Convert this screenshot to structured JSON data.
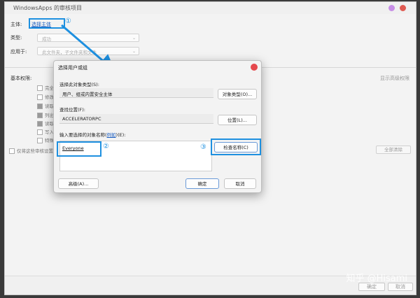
{
  "outer_window": {
    "title": "WindowsApps 的审核项目",
    "principal_label": "主体:",
    "principal_link": "选择主体",
    "type_label": "类型:",
    "type_value": "成功",
    "applies_label": "应用于:",
    "applies_value": "此文件夹，子文件夹和文件",
    "basic_permissions_label": "基本权限:",
    "show_advanced": "显示高级权限",
    "permissions": [
      {
        "label": "完全",
        "checked": false
      },
      {
        "label": "修改",
        "checked": false
      },
      {
        "label": "读取",
        "checked": true
      },
      {
        "label": "列出",
        "checked": true
      },
      {
        "label": "读取",
        "checked": true
      },
      {
        "label": "写入",
        "checked": false
      },
      {
        "label": "特殊",
        "checked": false
      }
    ],
    "only_apply": "仅将这些审核设置",
    "clear_all": "全部清除",
    "ok": "确定",
    "cancel": "取消"
  },
  "dialog": {
    "title": "选择用户或组",
    "object_type_label": "选择此对象类型(S):",
    "object_type_value": "用户、组或内置安全主体",
    "object_types_button": "对象类型(O)...",
    "location_label": "查找位置(F):",
    "location_value": "ACCELERATORPC",
    "locations_button": "位置(L)...",
    "enter_names_label_pre": "输入要选择的对象名称(",
    "enter_names_link": "例如",
    "enter_names_label_post": ")(E):",
    "entered_name": "Everyone",
    "check_names_button": "检查名称(C)",
    "advanced_button": "高级(A)...",
    "ok_button": "确定",
    "cancel_button": "取消"
  },
  "annotations": {
    "badge1": "①",
    "badge2": "②",
    "badge3": "③",
    "accent_color": "#1e90e0"
  },
  "watermark": "知乎 @Hisami"
}
